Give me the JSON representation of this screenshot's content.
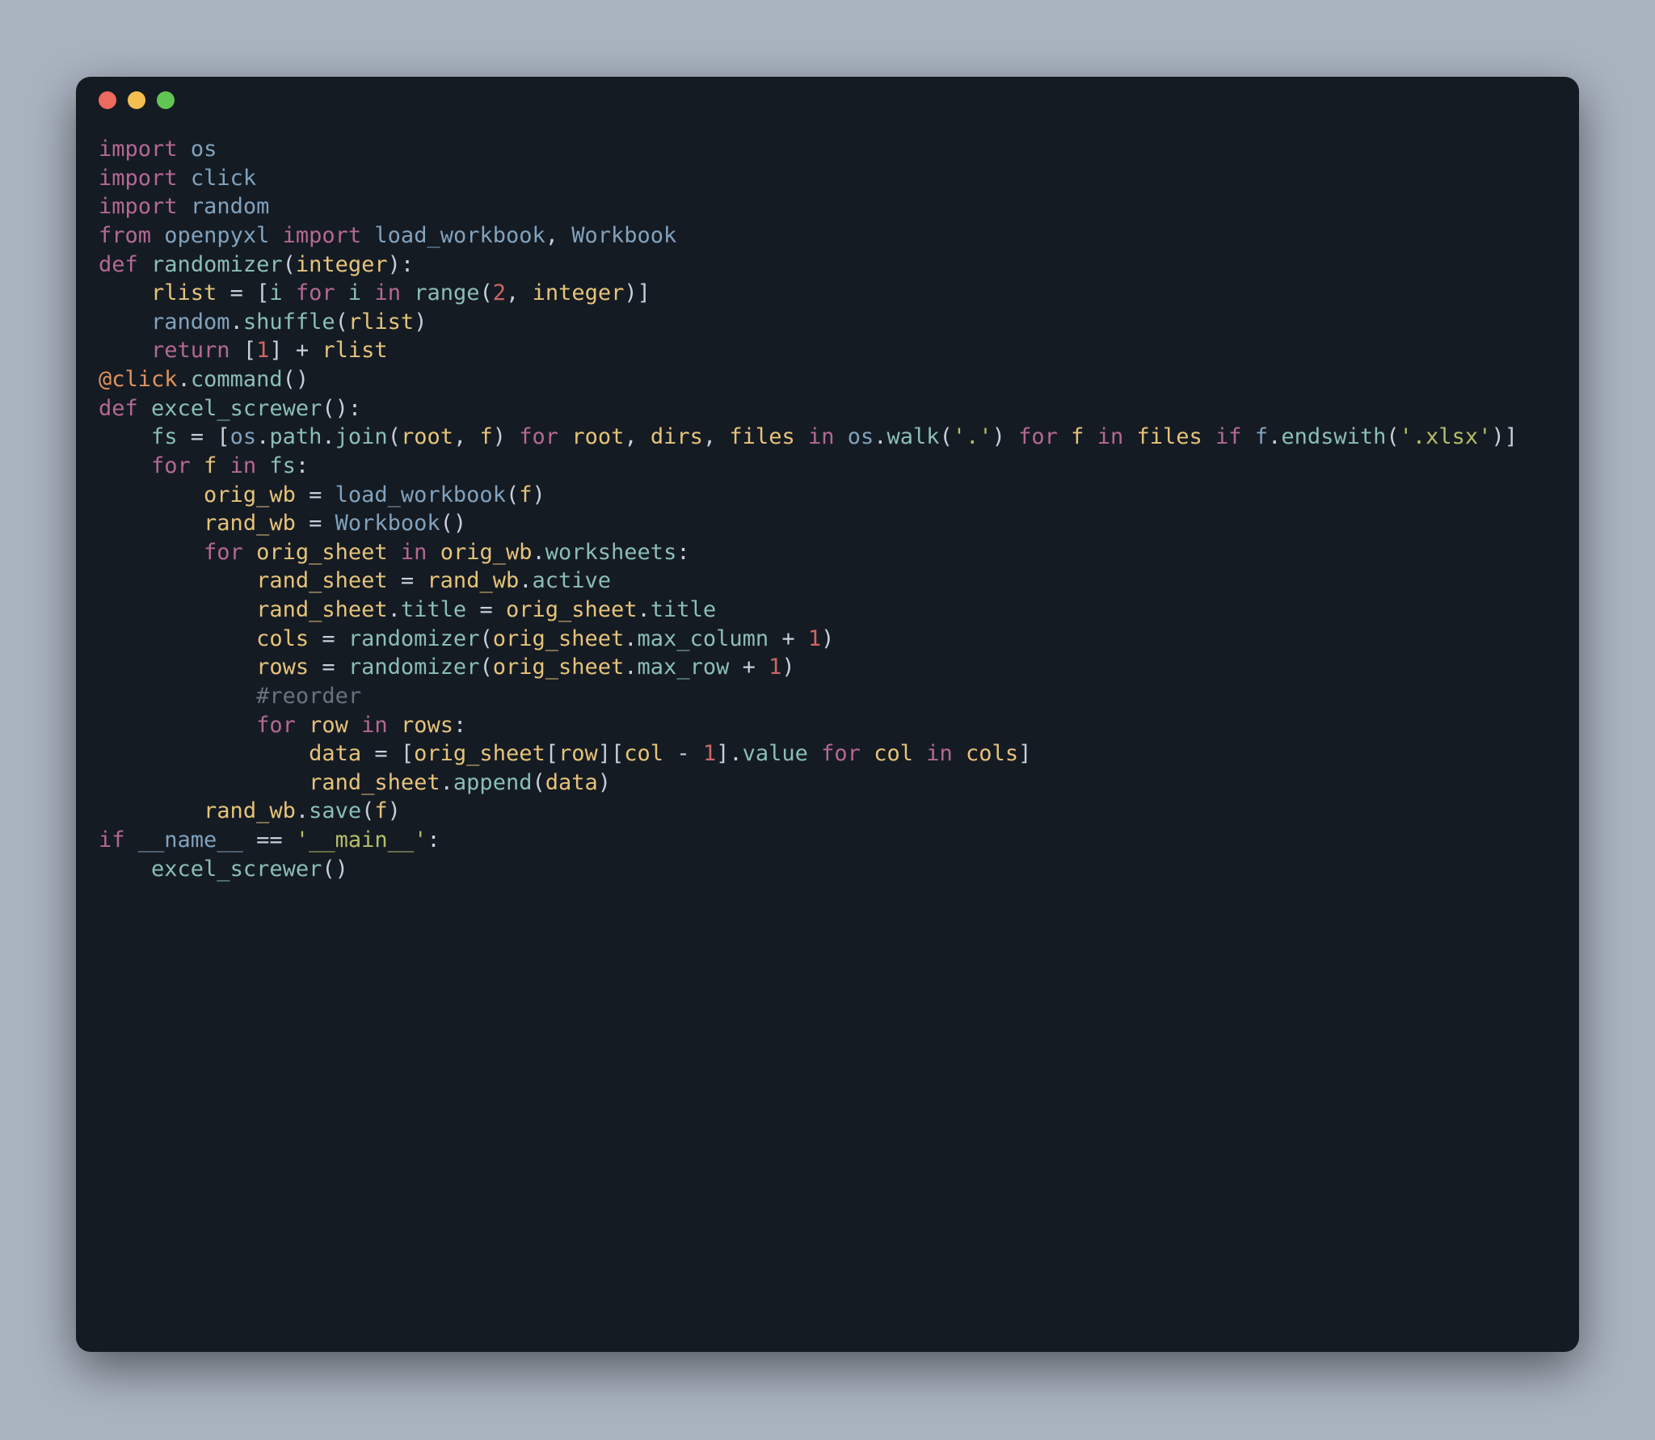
{
  "window": {
    "traffic_lights": [
      "close",
      "minimize",
      "zoom"
    ]
  },
  "code": {
    "lines": [
      [
        [
          "kw",
          "import"
        ],
        [
          "",
          " "
        ],
        [
          "mod",
          "os"
        ]
      ],
      [
        [
          "kw",
          "import"
        ],
        [
          "",
          " "
        ],
        [
          "mod",
          "click"
        ]
      ],
      [
        [
          "kw",
          "import"
        ],
        [
          "",
          " "
        ],
        [
          "mod",
          "random"
        ]
      ],
      [
        [
          "kw",
          "from"
        ],
        [
          "",
          " "
        ],
        [
          "mod",
          "openpyxl"
        ],
        [
          "",
          " "
        ],
        [
          "kw",
          "import"
        ],
        [
          "",
          " "
        ],
        [
          "mod",
          "load_workbook"
        ],
        [
          "",
          ", "
        ],
        [
          "mod",
          "Workbook"
        ]
      ],
      [
        [
          "",
          ""
        ]
      ],
      [
        [
          "kw",
          "def"
        ],
        [
          "",
          " "
        ],
        [
          "bi",
          "randomizer"
        ],
        [
          "",
          "("
        ],
        [
          "id",
          "integer"
        ],
        [
          "",
          "):"
        ]
      ],
      [
        [
          "",
          "    "
        ],
        [
          "id",
          "rlist"
        ],
        [
          "",
          " = ["
        ],
        [
          "bi",
          "i"
        ],
        [
          "",
          " "
        ],
        [
          "kw",
          "for"
        ],
        [
          "",
          " "
        ],
        [
          "bi",
          "i"
        ],
        [
          "",
          " "
        ],
        [
          "kw",
          "in"
        ],
        [
          "",
          " "
        ],
        [
          "bi",
          "range"
        ],
        [
          "",
          "("
        ],
        [
          "num",
          "2"
        ],
        [
          "",
          ", "
        ],
        [
          "id",
          "integer"
        ],
        [
          "",
          ")]"
        ]
      ],
      [
        [
          "",
          "    "
        ],
        [
          "mod",
          "random"
        ],
        [
          "",
          "."
        ],
        [
          "bi",
          "shuffle"
        ],
        [
          "",
          "("
        ],
        [
          "id",
          "rlist"
        ],
        [
          "",
          ")"
        ]
      ],
      [
        [
          "",
          "    "
        ],
        [
          "kw",
          "return"
        ],
        [
          "",
          " ["
        ],
        [
          "num",
          "1"
        ],
        [
          "",
          "] + "
        ],
        [
          "id",
          "rlist"
        ]
      ],
      [
        [
          "",
          ""
        ]
      ],
      [
        [
          "at",
          "@click"
        ],
        [
          "",
          "."
        ],
        [
          "bi",
          "command"
        ],
        [
          "",
          "()"
        ]
      ],
      [
        [
          "kw",
          "def"
        ],
        [
          "",
          " "
        ],
        [
          "bi",
          "excel_screwer"
        ],
        [
          "",
          "():"
        ]
      ],
      [
        [
          "",
          "    "
        ],
        [
          "bi",
          "fs"
        ],
        [
          "",
          " = ["
        ],
        [
          "mod",
          "os"
        ],
        [
          "",
          "."
        ],
        [
          "bi",
          "path"
        ],
        [
          "",
          "."
        ],
        [
          "bi",
          "join"
        ],
        [
          "",
          "("
        ],
        [
          "id",
          "root"
        ],
        [
          "",
          ", "
        ],
        [
          "id",
          "f"
        ],
        [
          "",
          ") "
        ],
        [
          "kw",
          "for"
        ],
        [
          "",
          " "
        ],
        [
          "id",
          "root"
        ],
        [
          "",
          ", "
        ],
        [
          "id",
          "dirs"
        ],
        [
          "",
          ", "
        ],
        [
          "id",
          "files"
        ],
        [
          "",
          " "
        ],
        [
          "kw",
          "in"
        ],
        [
          "",
          " "
        ],
        [
          "mod",
          "os"
        ],
        [
          "",
          "."
        ],
        [
          "bi",
          "walk"
        ],
        [
          "",
          "("
        ],
        [
          "str",
          "'.'"
        ],
        [
          "",
          ") "
        ],
        [
          "kw",
          "for"
        ],
        [
          "",
          " "
        ],
        [
          "id",
          "f"
        ],
        [
          "",
          " "
        ],
        [
          "kw",
          "in"
        ],
        [
          "",
          " "
        ],
        [
          "id",
          "files"
        ],
        [
          "",
          " "
        ],
        [
          "kw",
          "if"
        ],
        [
          "",
          " "
        ],
        [
          "mod",
          "f"
        ],
        [
          "",
          "."
        ],
        [
          "bi",
          "endswith"
        ],
        [
          "",
          "("
        ],
        [
          "str",
          "'.xlsx'"
        ],
        [
          "",
          ")]"
        ]
      ],
      [
        [
          "",
          "    "
        ],
        [
          "kw",
          "for"
        ],
        [
          "",
          " "
        ],
        [
          "id",
          "f"
        ],
        [
          "",
          " "
        ],
        [
          "kw",
          "in"
        ],
        [
          "",
          " "
        ],
        [
          "bi",
          "fs"
        ],
        [
          "",
          ":"
        ]
      ],
      [
        [
          "",
          "        "
        ],
        [
          "id",
          "orig_wb"
        ],
        [
          "",
          " = "
        ],
        [
          "mod",
          "load_workbook"
        ],
        [
          "",
          "("
        ],
        [
          "id",
          "f"
        ],
        [
          "",
          ")"
        ]
      ],
      [
        [
          "",
          "        "
        ],
        [
          "id",
          "rand_wb"
        ],
        [
          "",
          " = "
        ],
        [
          "mod",
          "Workbook"
        ],
        [
          "",
          "()"
        ]
      ],
      [
        [
          "",
          "        "
        ],
        [
          "kw",
          "for"
        ],
        [
          "",
          " "
        ],
        [
          "id",
          "orig_sheet"
        ],
        [
          "",
          " "
        ],
        [
          "kw",
          "in"
        ],
        [
          "",
          " "
        ],
        [
          "id",
          "orig_wb"
        ],
        [
          "",
          "."
        ],
        [
          "bi",
          "worksheets"
        ],
        [
          "",
          ":"
        ]
      ],
      [
        [
          "",
          "            "
        ],
        [
          "id",
          "rand_sheet"
        ],
        [
          "",
          " = "
        ],
        [
          "id",
          "rand_wb"
        ],
        [
          "",
          "."
        ],
        [
          "bi",
          "active"
        ]
      ],
      [
        [
          "",
          "            "
        ],
        [
          "id",
          "rand_sheet"
        ],
        [
          "",
          "."
        ],
        [
          "bi",
          "title"
        ],
        [
          "",
          " = "
        ],
        [
          "id",
          "orig_sheet"
        ],
        [
          "",
          "."
        ],
        [
          "bi",
          "title"
        ]
      ],
      [
        [
          "",
          "            "
        ],
        [
          "id",
          "cols"
        ],
        [
          "",
          " = "
        ],
        [
          "bi",
          "randomizer"
        ],
        [
          "",
          "("
        ],
        [
          "id",
          "orig_sheet"
        ],
        [
          "",
          "."
        ],
        [
          "bi",
          "max_column"
        ],
        [
          "",
          " + "
        ],
        [
          "num",
          "1"
        ],
        [
          "",
          ")"
        ]
      ],
      [
        [
          "",
          "            "
        ],
        [
          "id",
          "rows"
        ],
        [
          "",
          " = "
        ],
        [
          "bi",
          "randomizer"
        ],
        [
          "",
          "("
        ],
        [
          "id",
          "orig_sheet"
        ],
        [
          "",
          "."
        ],
        [
          "bi",
          "max_row"
        ],
        [
          "",
          " + "
        ],
        [
          "num",
          "1"
        ],
        [
          "",
          ")"
        ]
      ],
      [
        [
          "",
          ""
        ]
      ],
      [
        [
          "",
          "            "
        ],
        [
          "cm",
          "#reorder"
        ]
      ],
      [
        [
          "",
          "            "
        ],
        [
          "kw",
          "for"
        ],
        [
          "",
          " "
        ],
        [
          "id",
          "row"
        ],
        [
          "",
          " "
        ],
        [
          "kw",
          "in"
        ],
        [
          "",
          " "
        ],
        [
          "id",
          "rows"
        ],
        [
          "",
          ":"
        ]
      ],
      [
        [
          "",
          "                "
        ],
        [
          "id",
          "data"
        ],
        [
          "",
          " = ["
        ],
        [
          "id",
          "orig_sheet"
        ],
        [
          "",
          "["
        ],
        [
          "id",
          "row"
        ],
        [
          "",
          "]["
        ],
        [
          "id",
          "col"
        ],
        [
          "",
          " - "
        ],
        [
          "num",
          "1"
        ],
        [
          "",
          "]."
        ],
        [
          "bi",
          "value"
        ],
        [
          "",
          " "
        ],
        [
          "kw",
          "for"
        ],
        [
          "",
          " "
        ],
        [
          "id",
          "col"
        ],
        [
          "",
          " "
        ],
        [
          "kw",
          "in"
        ],
        [
          "",
          " "
        ],
        [
          "id",
          "cols"
        ],
        [
          "",
          "]"
        ]
      ],
      [
        [
          "",
          "                "
        ],
        [
          "id",
          "rand_sheet"
        ],
        [
          "",
          "."
        ],
        [
          "bi",
          "append"
        ],
        [
          "",
          "("
        ],
        [
          "id",
          "data"
        ],
        [
          "",
          ")"
        ]
      ],
      [
        [
          "",
          "        "
        ],
        [
          "id",
          "rand_wb"
        ],
        [
          "",
          "."
        ],
        [
          "bi",
          "save"
        ],
        [
          "",
          "("
        ],
        [
          "id",
          "f"
        ],
        [
          "",
          ")"
        ]
      ],
      [
        [
          "",
          ""
        ]
      ],
      [
        [
          "kw",
          "if"
        ],
        [
          "",
          " "
        ],
        [
          "mod",
          "__name__"
        ],
        [
          "",
          " == "
        ],
        [
          "str",
          "'__main__'"
        ],
        [
          "",
          ":"
        ]
      ],
      [
        [
          "",
          "    "
        ],
        [
          "bi",
          "excel_screwer"
        ],
        [
          "",
          "()"
        ]
      ]
    ]
  }
}
